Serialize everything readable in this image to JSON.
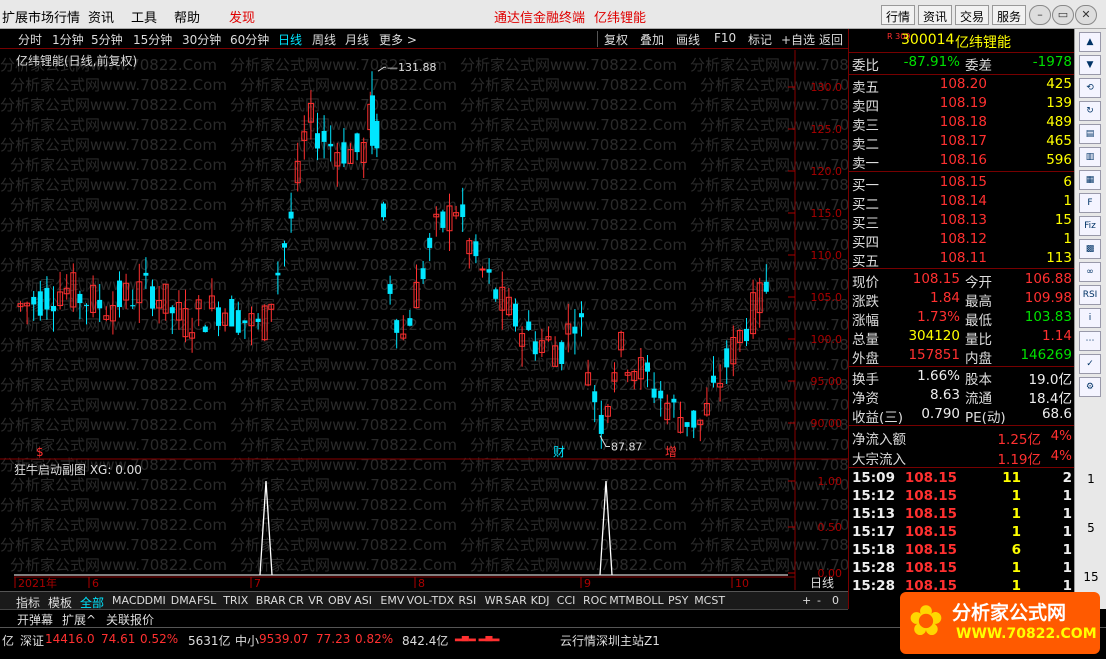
{
  "menu": {
    "items": [
      "扩展市场行情",
      "资讯",
      "工具",
      "帮助"
    ],
    "faxian": "发现",
    "center_title": "通达信金融终端",
    "center_stock": "亿纬锂能",
    "right_buttons": [
      "行情",
      "资讯",
      "交易",
      "服务"
    ]
  },
  "periods": [
    "分时",
    "1分钟",
    "5分钟",
    "15分钟",
    "30分钟",
    "60分钟",
    "日线",
    "周线",
    "月线",
    "更多 >"
  ],
  "active_period": "日线",
  "tools": [
    "复权",
    "叠加",
    "画线",
    "F10",
    "标记",
    "+自选",
    "返回"
  ],
  "chart": {
    "title": "亿纬锂能(日线,前复权)",
    "hi_label": "131.88",
    "lo_label": "87.87",
    "markers": [
      "财",
      "增",
      "$"
    ],
    "indicator_label": "狂牛启动副图 XG: 0.00",
    "xlabels": [
      "2021年",
      "6",
      "7",
      "8",
      "9",
      "10"
    ],
    "period_label": "日线",
    "y_main": [
      "130.0",
      "125.0",
      "120.0",
      "115.0",
      "110.0",
      "105.0",
      "100.0",
      "95.00",
      "90.00"
    ],
    "y_sub": [
      "1.00",
      "0.50",
      "0.00"
    ],
    "watermark": "分析家公式网www.70822.Com"
  },
  "quote": {
    "code": "300014",
    "name": "亿纬锂能",
    "board": "R 300",
    "weibi_label": "委比",
    "weibi": "-87.91%",
    "weicha_label": "委差",
    "weicha": "-1978",
    "asks": [
      {
        "label": "卖五",
        "price": "108.20",
        "vol": "425"
      },
      {
        "label": "卖四",
        "price": "108.19",
        "vol": "139"
      },
      {
        "label": "卖三",
        "price": "108.18",
        "vol": "489"
      },
      {
        "label": "卖二",
        "price": "108.17",
        "vol": "465"
      },
      {
        "label": "卖一",
        "price": "108.16",
        "vol": "596"
      }
    ],
    "bids": [
      {
        "label": "买一",
        "price": "108.15",
        "vol": "6"
      },
      {
        "label": "买二",
        "price": "108.14",
        "vol": "1"
      },
      {
        "label": "买三",
        "price": "108.13",
        "vol": "15"
      },
      {
        "label": "买四",
        "price": "108.12",
        "vol": "1"
      },
      {
        "label": "买五",
        "price": "108.11",
        "vol": "113"
      }
    ],
    "stats": [
      {
        "l1": "现价",
        "v1": "108.15",
        "c1": "red",
        "l2": "今开",
        "v2": "106.88",
        "c2": "red"
      },
      {
        "l1": "涨跌",
        "v1": "1.84",
        "c1": "red",
        "l2": "最高",
        "v2": "109.98",
        "c2": "red"
      },
      {
        "l1": "涨幅",
        "v1": "1.73%",
        "c1": "red",
        "l2": "最低",
        "v2": "103.83",
        "c2": "grn"
      },
      {
        "l1": "总量",
        "v1": "304120",
        "c1": "yel",
        "l2": "量比",
        "v2": "1.14",
        "c2": "red"
      },
      {
        "l1": "外盘",
        "v1": "157851",
        "c1": "red",
        "l2": "内盘",
        "v2": "146269",
        "c2": "grn"
      }
    ],
    "stats2": [
      {
        "l1": "换手",
        "v1": "1.66%",
        "l2": "股本",
        "v2": "19.0亿"
      },
      {
        "l1": "净资",
        "v1": "8.63",
        "l2": "流通",
        "v2": "18.4亿"
      },
      {
        "l1": "收益(三)",
        "v1": "0.790",
        "l2": "PE(动)",
        "v2": "68.6"
      }
    ],
    "flows": [
      {
        "label": "净流入额",
        "val": "1.25亿",
        "pct": "4%"
      },
      {
        "label": "大宗流入",
        "val": "1.19亿",
        "pct": "4%"
      }
    ],
    "ticks": [
      {
        "t": "15:09",
        "p": "108.15",
        "v": "11",
        "n": "2"
      },
      {
        "t": "15:12",
        "p": "108.15",
        "v": "1",
        "n": "1"
      },
      {
        "t": "15:13",
        "p": "108.15",
        "v": "1",
        "n": "1"
      },
      {
        "t": "15:17",
        "p": "108.15",
        "v": "1",
        "n": "1"
      },
      {
        "t": "15:18",
        "p": "108.15",
        "v": "6",
        "n": "1"
      },
      {
        "t": "15:28",
        "p": "108.15",
        "v": "1",
        "n": "1"
      },
      {
        "t": "15:28",
        "p": "108.15",
        "v": "1",
        "n": "1"
      }
    ]
  },
  "iconbar": {
    "icons": [
      "up-arrow",
      "down-arrow",
      "refresh",
      "cycle",
      "chart",
      "bar",
      "doc",
      "f10",
      "fiz",
      "grid",
      "link",
      "rsi",
      "info",
      "dots",
      "tick",
      "gear"
    ],
    "nums": [
      "1",
      "5",
      "15"
    ]
  },
  "bottom_tabs": [
    "指标",
    "模板",
    "全部",
    "MACD",
    "DMI",
    "DMA",
    "FSL",
    "TRIX",
    "BRAR",
    "CR",
    "VR",
    "OBV",
    "ASI",
    "EMV",
    "VOL-TDX",
    "RSI",
    "WR",
    "SAR",
    "KDJ",
    "CCI",
    "ROC",
    "MTM",
    "BOLL",
    "PSY",
    "MCST"
  ],
  "active_tab": "全部",
  "tab2": [
    "开弹幕",
    "扩展^",
    "关联报价"
  ],
  "status": {
    "a": "亿",
    "sz_label": "深证",
    "sz_val": "14416.0",
    "sz_chg": "74.61",
    "sz_pct": "0.52%",
    "sz_amt": "5631亿",
    "zx_label": "中小",
    "zx_val": "9539.07",
    "zx_chg": "77.23",
    "zx_pct": "0.82%",
    "zx_amt": "842.4亿",
    "server": "云行情深圳主站Z1"
  },
  "logo": {
    "title": "分析家公式网",
    "url": "WWW.70822.COM"
  },
  "colors": {
    "up": "#ff3030",
    "down": "#00e6ff",
    "bg": "#000000"
  }
}
